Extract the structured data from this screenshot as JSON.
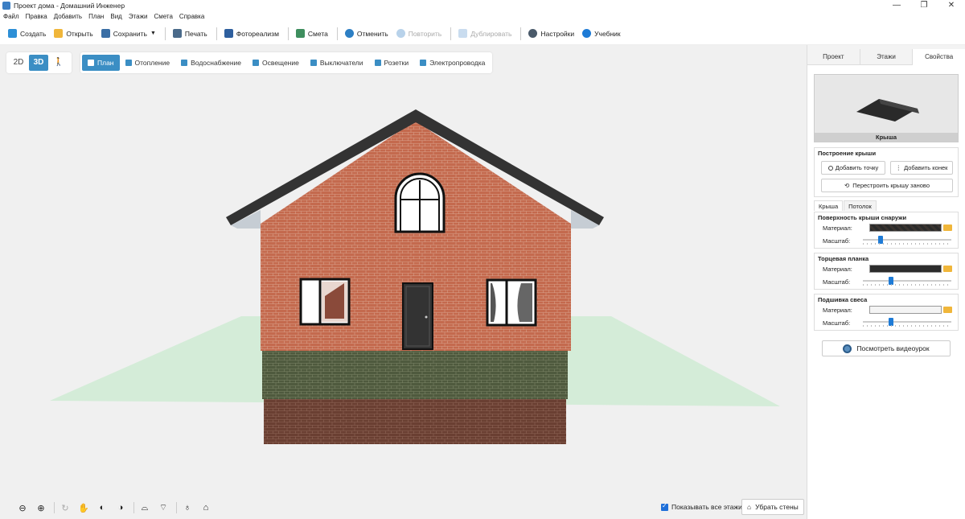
{
  "window": {
    "title": "Проект дома - Домашний Инженер",
    "minimize": "—",
    "maximize": "❐",
    "close": "✕"
  },
  "menu": [
    "Файл",
    "Правка",
    "Добавить",
    "План",
    "Вид",
    "Этажи",
    "Смета",
    "Справка"
  ],
  "toolbar": {
    "create": "Создать",
    "open": "Открыть",
    "save": "Сохранить",
    "print": "Печать",
    "photorealism": "Фотореализм",
    "estimate": "Смета",
    "undo": "Отменить",
    "redo": "Повторить",
    "duplicate": "Дублировать",
    "settings": "Настройки",
    "tutorial": "Учебник"
  },
  "view_modes": {
    "mode_2d": "2D",
    "mode_3d": "3D",
    "walk": "🚶",
    "active": "3D"
  },
  "layers": [
    "План",
    "Отопление",
    "Водоснабжение",
    "Освещение",
    "Выключатели",
    "Розетки",
    "Электропроводка"
  ],
  "bottom": {
    "show_all_floors": "Показывать все этажи",
    "remove_walls": "Убрать стены"
  },
  "panel": {
    "tabs": [
      "Проект",
      "Этажи",
      "Свойства"
    ],
    "active_tab": "Свойства",
    "preview_label": "Крыша",
    "roof_build": {
      "title": "Построение крыши",
      "add_point": "Добавить точку",
      "add_ridge": "Добавить конек",
      "rebuild": "Перестроить крышу заново"
    },
    "subtabs": [
      "Крыша",
      "Потолок"
    ],
    "outer_surface": {
      "title": "Поверхность крыши снаружи",
      "material_label": "Материал:",
      "scale_label": "Масштаб:",
      "scale": 0.2
    },
    "fascia": {
      "title": "Торцевая планка",
      "material_label": "Материал:",
      "scale_label": "Масштаб:",
      "scale": 0.32
    },
    "soffit": {
      "title": "Подшивка свеса",
      "material_label": "Материал:",
      "scale_label": "Масштаб:",
      "scale": 0.32
    },
    "video": "Посмотреть видеоурок"
  },
  "colors": {
    "accent": "#3b8ec4",
    "brick": "#c46a4e",
    "roof": "#333333",
    "ground": "#d4ecd8"
  }
}
